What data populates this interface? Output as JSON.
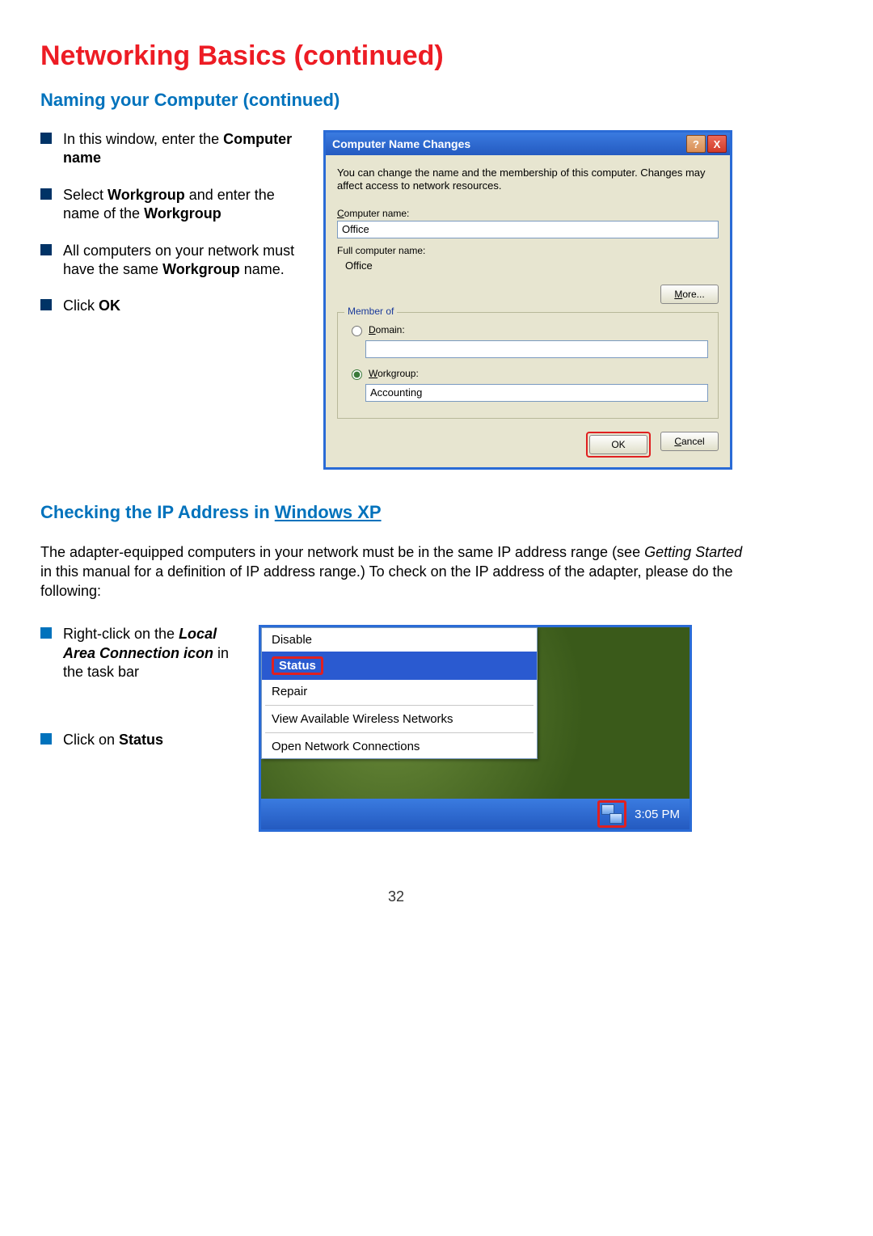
{
  "page_title": "Networking Basics (continued)",
  "section1_title": "Naming your Computer (continued)",
  "bullets1": {
    "a_pre": "In this window, enter the ",
    "a_bold": "Computer name",
    "b_pre": "Select ",
    "b_bold1": "Workgroup",
    "b_mid": " and enter the name of the ",
    "b_bold2": "Workgroup",
    "c_pre": "All computers on your network must have the same ",
    "c_bold": "Workgroup",
    "c_post": " name.",
    "d_pre": "Click ",
    "d_bold": "OK"
  },
  "dialog": {
    "title": "Computer Name Changes",
    "help": "?",
    "close": "X",
    "desc": "You can change the name and the membership of this computer. Changes may affect access to network resources.",
    "computer_name_label_u": "C",
    "computer_name_label_rest": "omputer name:",
    "computer_name_value": "Office",
    "full_name_label": "Full computer name:",
    "full_name_value": "Office",
    "more_u": "M",
    "more_rest": "ore...",
    "member_legend": "Member of",
    "domain_u": "D",
    "domain_rest": "omain:",
    "domain_value": "",
    "workgroup_u": "W",
    "workgroup_rest": "orkgroup:",
    "workgroup_value": "Accounting",
    "ok": "OK",
    "cancel_u": "C",
    "cancel_rest": "ancel"
  },
  "section2_title_pre": "Checking the IP Address in ",
  "section2_title_uline": "Windows XP",
  "paragraph_pre": "The adapter-equipped computers in your network must be in the same IP address range (see ",
  "paragraph_ital": "Getting Started",
  "paragraph_post": " in this manual for a definition of IP address range.)  To check on the IP address of the adapter, please do the following:",
  "bullets2": {
    "a_pre": "Right-click on the ",
    "a_bolditalic": "Local Area Connection icon",
    "a_post": " in the task bar",
    "b_pre": "Click on ",
    "b_bold": "Status"
  },
  "ctx": {
    "disable": "Disable",
    "status": "Status",
    "repair": "Repair",
    "view": "View Available Wireless Networks",
    "open": "Open Network Connections",
    "clock": "3:05 PM"
  },
  "page_number": "32"
}
